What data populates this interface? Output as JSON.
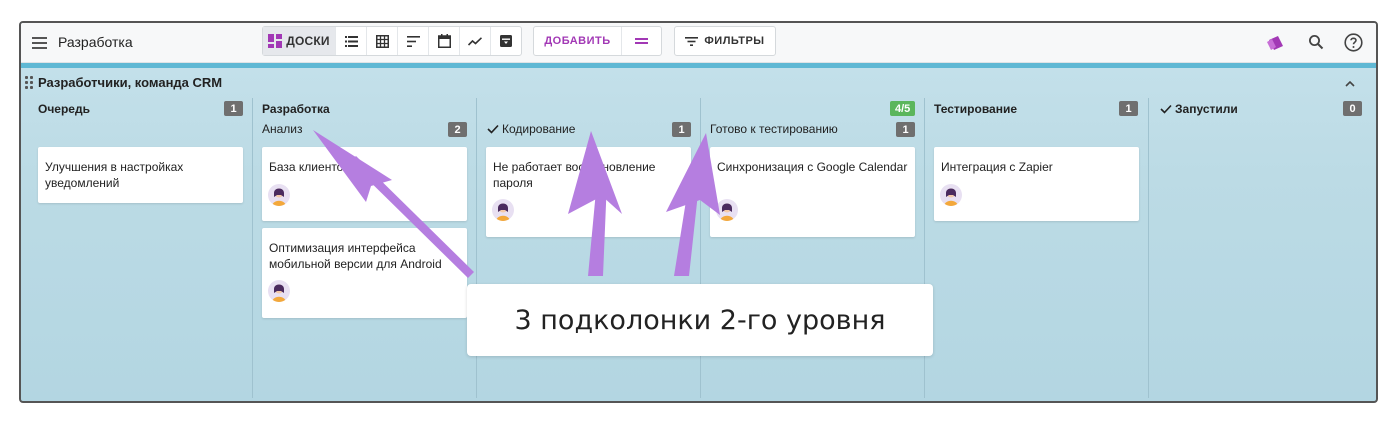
{
  "app": {
    "title": "Разработка"
  },
  "toolbar": {
    "views": [
      {
        "name": "boards",
        "label": "ДОСКИ",
        "icon": "boards-icon",
        "active": true
      },
      {
        "name": "list",
        "icon": "list-icon"
      },
      {
        "name": "table",
        "icon": "grid-icon"
      },
      {
        "name": "sort",
        "icon": "sort-icon"
      },
      {
        "name": "calendar",
        "icon": "calendar-icon"
      },
      {
        "name": "chart",
        "icon": "chart-icon"
      },
      {
        "name": "archive",
        "icon": "archive-icon"
      }
    ],
    "add_label": "ДОБАВИТЬ",
    "filter_label": "ФИЛЬТРЫ",
    "accent_color": "#a238b5"
  },
  "board": {
    "title": "Разработчики, команда CRM",
    "columns": [
      {
        "title": "Очередь",
        "count": "1"
      },
      {
        "title": "Разработка",
        "count": "4/5",
        "subcolumns": [
          {
            "title": "Анализ",
            "count": "2"
          },
          {
            "title": "Кодирование",
            "count": "1",
            "check": true
          },
          {
            "title": "Готово к тестированию",
            "count": "1"
          }
        ]
      },
      {
        "title": "Тестирование",
        "count": "1"
      },
      {
        "title": "Запустили",
        "count": "0",
        "check": true
      }
    ],
    "cards": {
      "queue_1": "Улучшения в настройках уведомлений",
      "analysis_1": "База клиентов",
      "analysis_2": "Оптимизация интерфейса мобильной версии для Android",
      "coding_1": "Не работает восстановление пароля",
      "ready_1": "Синхронизация с Google Calendar",
      "testing_1": "Интеграция с Zapier"
    }
  },
  "annotation": {
    "text": "3 подколонки 2-го уровня",
    "arrow_color": "#b57ee0"
  },
  "colors": {
    "badge": "#6f6f6f",
    "badge_green": "#5bb65c",
    "board_bg": "#c6e2ec"
  }
}
